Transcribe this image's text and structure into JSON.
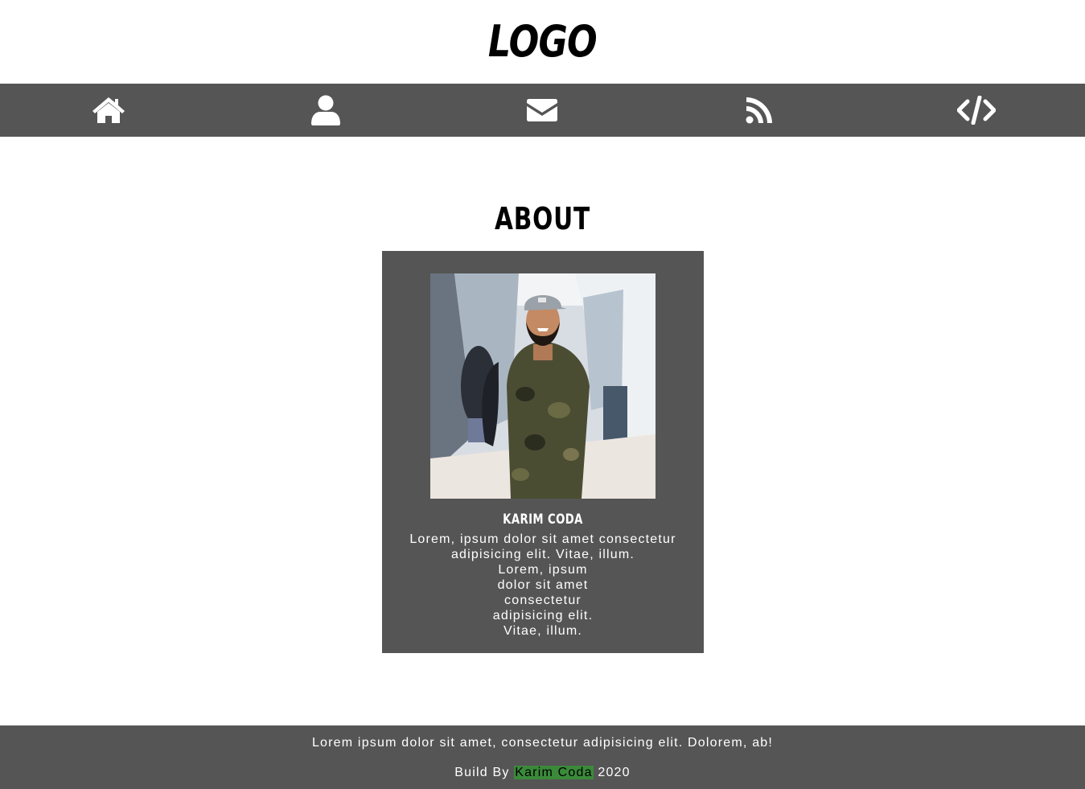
{
  "header": {
    "logo_text": "LOGO"
  },
  "nav": {
    "items": [
      {
        "icon": "home-icon"
      },
      {
        "icon": "user-icon"
      },
      {
        "icon": "envelope-icon"
      },
      {
        "icon": "rss-icon"
      },
      {
        "icon": "code-icon"
      }
    ]
  },
  "about": {
    "title": "ABOUT",
    "card": {
      "name": "KARIM CODA",
      "text_lines": [
        "Lorem, ipsum dolor sit amet consectetur",
        "adipisicing elit. Vitae, illum.",
        "Lorem, ipsum",
        "dolor sit amet",
        "consectetur",
        "adipisicing elit.",
        "Vitae, illum."
      ]
    }
  },
  "footer": {
    "text": "Lorem ipsum dolor sit amet, consectetur adipisicing elit. Dolorem, ab!",
    "build_prefix": "Build By",
    "author": "Karim Coda",
    "year": "2020"
  },
  "colors": {
    "nav_bg": "#555555",
    "card_bg": "#555555",
    "footer_bg": "#555555",
    "author_highlight": "#3a8a3a"
  }
}
